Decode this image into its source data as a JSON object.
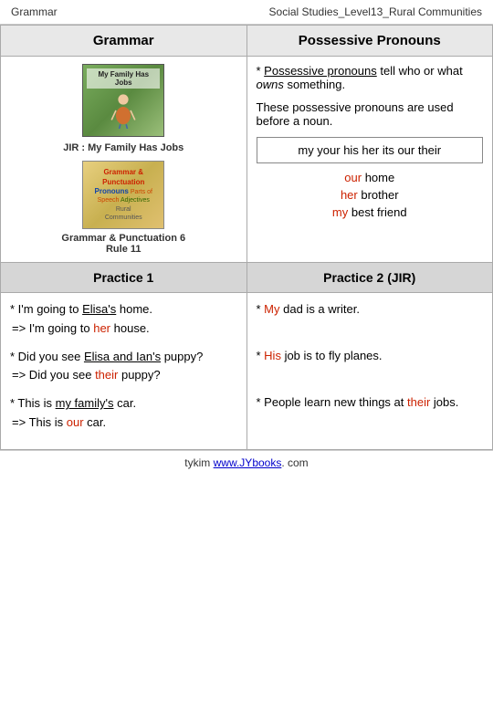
{
  "topbar": {
    "left": "Grammar",
    "right": "Social Studies_Level13_Rural Communities"
  },
  "header": {
    "col1": "Grammar",
    "col2": "Possessive Pronouns"
  },
  "grammar": {
    "book1_title": "My Family Has Jobs",
    "book1_caption": "JIR : My Family Has Jobs",
    "book2_caption": "Grammar & Punctuation 6",
    "book2_rule": "Rule 11"
  },
  "pronouns": {
    "intro1": "* Possessive pronouns tell who or what ",
    "intro1_italic": "owns",
    "intro1_end": " something.",
    "intro2": "These possessive pronouns are used before a noun.",
    "box_text": "my  your  his  her  its  our  their",
    "example1_colored": "our",
    "example1_rest": " home",
    "example2_colored": "her",
    "example2_rest": " brother",
    "example3_colored": "my",
    "example3_rest": " best friend"
  },
  "practice": {
    "col1_header": "Practice 1",
    "col2_header": "Practice 2 (JIR)",
    "left": {
      "item1_line1": "* I'm going to ",
      "item1_underline": "Elisa's",
      "item1_end": " home.",
      "item1_arrow": "=> I'm going to ",
      "item1_arrow_colored": "her",
      "item1_arrow_end": " house.",
      "item2_line1": "* Did you see ",
      "item2_underline": "Elisa and Ian's",
      "item2_end": " puppy?",
      "item2_arrow": "=> Did you see ",
      "item2_arrow_colored": "their",
      "item2_arrow_end": " puppy?",
      "item3_line1": "* This is ",
      "item3_underline": "my family's",
      "item3_end": " car.",
      "item3_arrow": "=> This is ",
      "item3_arrow_colored": "our",
      "item3_arrow_end": " car."
    },
    "right": {
      "item1_start": "* ",
      "item1_colored": "My",
      "item1_end": " dad is a writer.",
      "item2_start": "* ",
      "item2_colored": "His",
      "item2_end": " job is to fly planes.",
      "item3_start": "* People learn new things at ",
      "item3_colored": "their",
      "item3_end": " jobs."
    }
  },
  "footer": {
    "text": "tykim ",
    "link": "www.JYbooks",
    "end": ". com"
  }
}
